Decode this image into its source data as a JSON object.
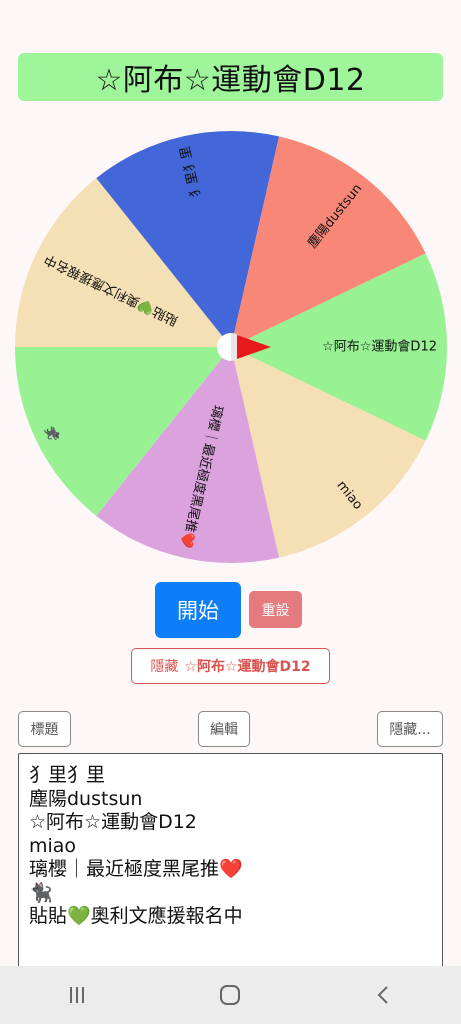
{
  "title": "☆阿布☆運動會D12",
  "wheel": {
    "slices": [
      {
        "label": "☆阿布☆運動會D12",
        "color": "#98f294"
      },
      {
        "label": "miao",
        "color": "#f5dfb4"
      },
      {
        "label": "璃櫻｜最近極度黑尾推❤️",
        "color": "#dba2dd"
      },
      {
        "label": "🐈‍⬛",
        "color": "#98f294"
      },
      {
        "label": "貼貼💚奧利文應援報名中",
        "color": "#f5dfb4"
      },
      {
        "label": "犭里犭里",
        "color": "#4366d8"
      },
      {
        "label": "塵陽dustsun",
        "color": "#f98778"
      }
    ],
    "pointer_color": "#e8191b"
  },
  "buttons": {
    "start": "開始",
    "reset": "重設",
    "hide_prefix": "隱藏",
    "hide_item": "☆阿布☆運動會D12",
    "title": "標題",
    "edit": "編輯",
    "hide_more": "隱藏..."
  },
  "entries": [
    "犭里犭里",
    "塵陽dustsun",
    "☆阿布☆運動會D12",
    "miao",
    "璃櫻｜最近極度黑尾推❤️",
    "🐈‍⬛",
    "貼貼💚奧利文應援報名中"
  ],
  "navbar": {
    "icons": [
      "recent-apps-icon",
      "home-icon",
      "back-icon"
    ]
  }
}
